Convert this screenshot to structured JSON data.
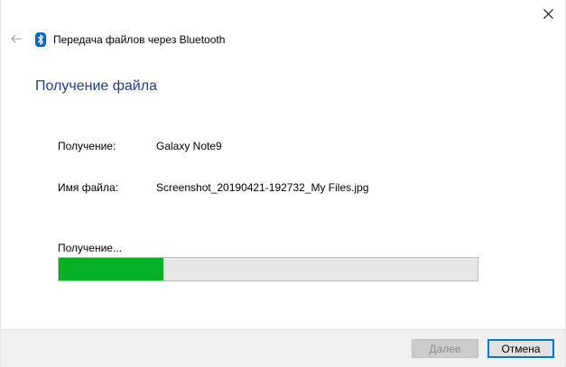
{
  "window": {
    "title": "Передача файлов через Bluetooth",
    "close_icon": "close-icon",
    "back_icon": "back-arrow-icon",
    "app_icon": "bluetooth-icon",
    "accent_color": "#1e3f8c"
  },
  "main": {
    "heading": "Получение файла",
    "fields": [
      {
        "label": "Получение:",
        "value": "Galaxy Note9"
      },
      {
        "label": "Имя файла:",
        "value": "Screenshot_20190421-192732_My Files.jpg"
      }
    ],
    "status": "Получение...",
    "progress": {
      "percent": 25,
      "fill_color": "#06b025"
    }
  },
  "footer": {
    "next_label": "Далее",
    "next_enabled": false,
    "cancel_label": "Отмена"
  }
}
